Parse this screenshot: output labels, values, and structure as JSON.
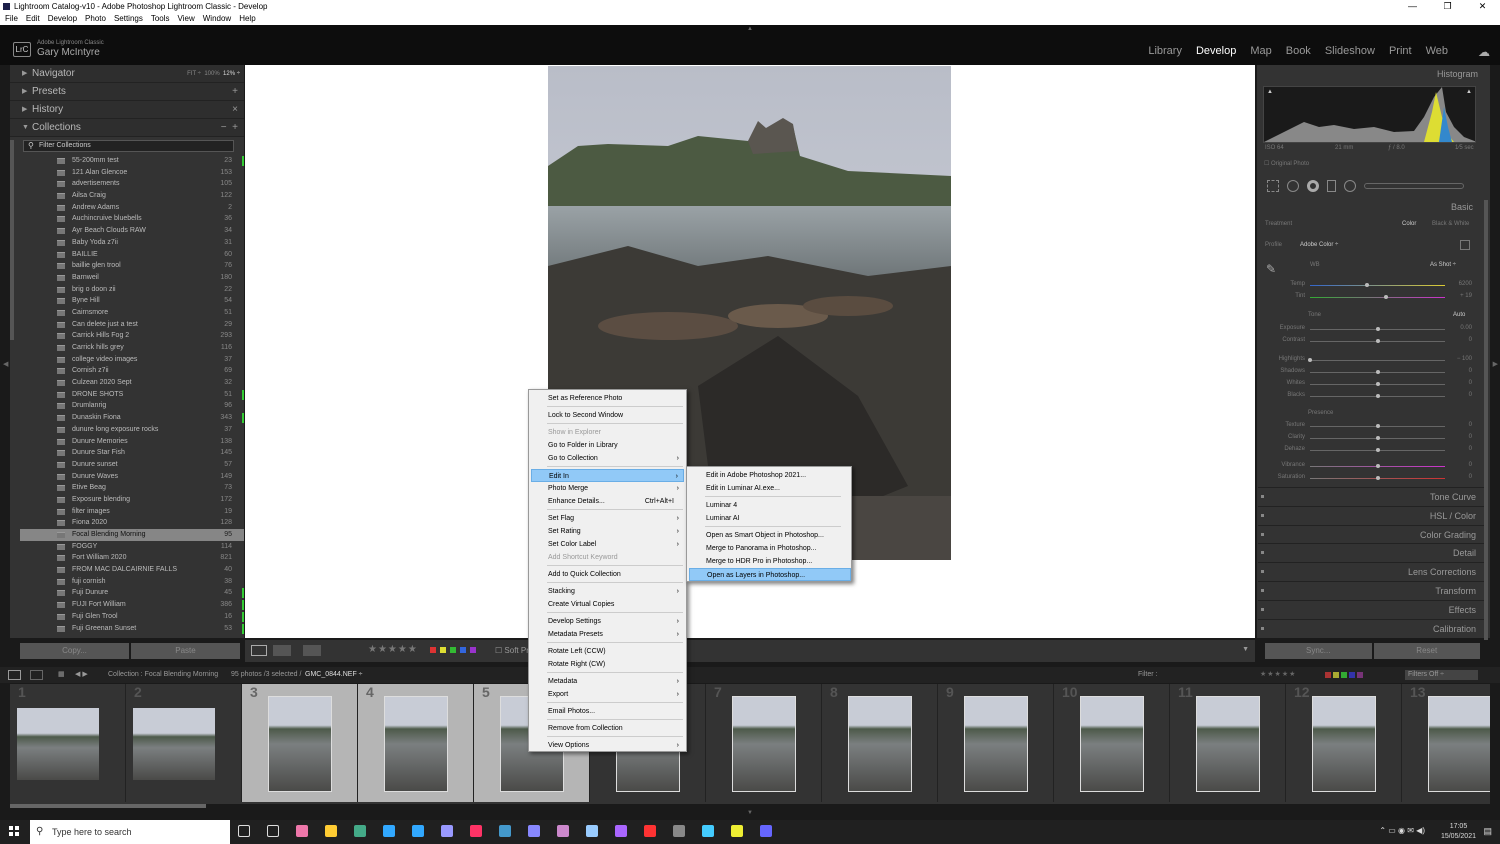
{
  "window": {
    "title": "Lightroom Catalog-v10 - Adobe Photoshop Lightroom Classic - Develop",
    "controls": [
      "—",
      "❐",
      "✕"
    ]
  },
  "menubar": [
    "File",
    "Edit",
    "Develop",
    "Photo",
    "Settings",
    "Tools",
    "View",
    "Window",
    "Help"
  ],
  "identity": {
    "app": "Adobe Lightroom Classic",
    "user": "Gary McIntyre",
    "logo": "LrC"
  },
  "modules": [
    "Library",
    "Develop",
    "Map",
    "Book",
    "Slideshow",
    "Print",
    "Web"
  ],
  "active_module": "Develop",
  "left_panel": {
    "navigator": {
      "label": "Navigator",
      "zoom_options": [
        "FIT ÷",
        "100%",
        "12% ÷"
      ]
    },
    "presets": "Presets",
    "history": "History",
    "collections": "Collections",
    "filter_placeholder": "Filter Collections",
    "items": [
      {
        "name": "55-200mm test",
        "count": "23",
        "mark": true
      },
      {
        "name": "121 Alan Glencoe",
        "count": "153"
      },
      {
        "name": "advertisements",
        "count": "105"
      },
      {
        "name": "Ailsa Craig",
        "count": "122"
      },
      {
        "name": "Andrew Adams",
        "count": "2"
      },
      {
        "name": "Auchincruive bluebells",
        "count": "36"
      },
      {
        "name": "Ayr Beach Clouds RAW",
        "count": "34"
      },
      {
        "name": "Baby Yoda z7ii",
        "count": "31"
      },
      {
        "name": "BAILLIE",
        "count": "60"
      },
      {
        "name": "baillie glen trool",
        "count": "76"
      },
      {
        "name": "Barnweil",
        "count": "180"
      },
      {
        "name": "brig o doon zii",
        "count": "22"
      },
      {
        "name": "Byne Hill",
        "count": "54"
      },
      {
        "name": "Cairnsmore",
        "count": "51"
      },
      {
        "name": "Can delete just a test",
        "count": "29"
      },
      {
        "name": "Carrick Hills Fog 2",
        "count": "293"
      },
      {
        "name": "Carrick hills grey",
        "count": "116"
      },
      {
        "name": "college video images",
        "count": "37"
      },
      {
        "name": "Cornish z7ii",
        "count": "69"
      },
      {
        "name": "Culzean 2020 Sept",
        "count": "32"
      },
      {
        "name": "DRONE SHOTS",
        "count": "51",
        "mark": true
      },
      {
        "name": "Drumlanrig",
        "count": "96"
      },
      {
        "name": "Dunaskin Fiona",
        "count": "343",
        "mark": true
      },
      {
        "name": "dunure long exposure rocks",
        "count": "37"
      },
      {
        "name": "Dunure Memories",
        "count": "138"
      },
      {
        "name": "Dunure Star Fish",
        "count": "145"
      },
      {
        "name": "Dunure sunset",
        "count": "57"
      },
      {
        "name": "Dunure Waves",
        "count": "149"
      },
      {
        "name": "Etive Beag",
        "count": "73"
      },
      {
        "name": "Exposure blending",
        "count": "172"
      },
      {
        "name": "filter images",
        "count": "19"
      },
      {
        "name": "Fiona 2020",
        "count": "128"
      },
      {
        "name": "Focal Blending Morning",
        "count": "95",
        "selected": true
      },
      {
        "name": "FOGGY",
        "count": "114"
      },
      {
        "name": "Fort William 2020",
        "count": "821"
      },
      {
        "name": "FROM MAC DALCAIRNIE FALLS",
        "count": "40"
      },
      {
        "name": "fuji cornish",
        "count": "38"
      },
      {
        "name": "Fuji Dunure",
        "count": "45",
        "mark": true
      },
      {
        "name": "FUJI Fort William",
        "count": "386",
        "mark": true
      },
      {
        "name": "Fuji Glen Trool",
        "count": "16",
        "mark": true
      },
      {
        "name": "Fuji Greenan Sunset",
        "count": "53",
        "mark": true
      }
    ],
    "copy": "Copy...",
    "paste": "Paste"
  },
  "toolbar": {
    "soft_proof": "Soft Pr"
  },
  "right_panel": {
    "histogram": "Histogram",
    "iso": "ISO 64",
    "focal": "21 mm",
    "aperture": "ƒ / 8.0",
    "shutter": "1⁄5 sec",
    "original_photo": "Original Photo",
    "basic": "Basic",
    "treatment": "Treatment",
    "color": "Color",
    "bw": "Black & White",
    "profile_label": "Profile",
    "profile": "Adobe Color ÷",
    "wb": "WB",
    "wb_value": "As Shot ÷",
    "sliders_wb": [
      {
        "name": "Temp",
        "value": "6200",
        "pos": 0.42
      },
      {
        "name": "Tint",
        "value": "+ 19",
        "pos": 0.56
      }
    ],
    "tone": "Tone",
    "auto": "Auto",
    "sliders_tone": [
      {
        "name": "Exposure",
        "value": "0.00",
        "pos": 0.5
      },
      {
        "name": "Contrast",
        "value": "0",
        "pos": 0.5
      },
      {
        "name": "Highlights",
        "value": "− 100",
        "pos": 0.0
      },
      {
        "name": "Shadows",
        "value": "0",
        "pos": 0.5
      },
      {
        "name": "Whites",
        "value": "0",
        "pos": 0.5
      },
      {
        "name": "Blacks",
        "value": "0",
        "pos": 0.5
      }
    ],
    "presence": "Presence",
    "sliders_presence": [
      {
        "name": "Texture",
        "value": "0",
        "pos": 0.5
      },
      {
        "name": "Clarity",
        "value": "0",
        "pos": 0.5
      },
      {
        "name": "Dehaze",
        "value": "0",
        "pos": 0.5
      },
      {
        "name": "Vibrance",
        "value": "0",
        "pos": 0.5
      },
      {
        "name": "Saturation",
        "value": "0",
        "pos": 0.5
      }
    ],
    "sections": [
      "Tone Curve",
      "HSL / Color",
      "Color Grading",
      "Detail",
      "Lens Corrections",
      "Transform",
      "Effects",
      "Calibration"
    ],
    "sync": "Sync...",
    "reset": "Reset"
  },
  "filmstrip": {
    "info": "Collection : Focal Blending Morning",
    "count": "95 photos /3 selected /",
    "file": "GMC_0844.NEF ÷",
    "filter": "Filter :",
    "filters_off": "Filters Off ÷",
    "cells": [
      "1",
      "2",
      "3",
      "4",
      "5",
      "6",
      "7",
      "8",
      "9",
      "10",
      "11",
      "12",
      "13"
    ]
  },
  "context_menu": {
    "items": [
      {
        "label": "Set as Reference Photo"
      },
      {
        "label": "Lock to Second Window"
      },
      {
        "label": "Show in Explorer",
        "disabled": true
      },
      {
        "label": "Go to Folder in Library"
      },
      {
        "label": "Go to Collection",
        "sub": true
      },
      {
        "label": "Edit In",
        "sub": true,
        "hl": true
      },
      {
        "label": "Photo Merge",
        "sub": true
      },
      {
        "label": "Enhance Details...",
        "shortcut": "Ctrl+Alt+I"
      },
      {
        "label": "Set Flag",
        "sub": true
      },
      {
        "label": "Set Rating",
        "sub": true
      },
      {
        "label": "Set Color Label",
        "sub": true
      },
      {
        "label": "Add Shortcut Keyword",
        "disabled": true
      },
      {
        "label": "Add to Quick Collection"
      },
      {
        "label": "Stacking",
        "sub": true
      },
      {
        "label": "Create Virtual Copies"
      },
      {
        "label": "Develop Settings",
        "sub": true
      },
      {
        "label": "Metadata Presets",
        "sub": true
      },
      {
        "label": "Rotate Left (CCW)"
      },
      {
        "label": "Rotate Right (CW)"
      },
      {
        "label": "Metadata",
        "sub": true
      },
      {
        "label": "Export",
        "sub": true
      },
      {
        "label": "Email Photos..."
      },
      {
        "label": "Remove from Collection"
      },
      {
        "label": "View Options",
        "sub": true
      }
    ],
    "submenu": [
      {
        "label": "Edit in Adobe Photoshop 2021..."
      },
      {
        "label": "Edit in Luminar AI.exe..."
      },
      {
        "label": "Luminar 4"
      },
      {
        "label": "Luminar AI"
      },
      {
        "label": "Open as Smart Object in Photoshop..."
      },
      {
        "label": "Merge to Panorama in Photoshop..."
      },
      {
        "label": "Merge to HDR Pro in Photoshop..."
      },
      {
        "label": "Open as Layers in Photoshop...",
        "hl": true
      }
    ]
  },
  "taskbar": {
    "search": "Type here to search",
    "time": "17:05",
    "date": "15/05/2021",
    "icons": [
      "task-view-icon",
      "timeline-icon",
      "photos-icon",
      "file-explorer-icon",
      "chrome-icon",
      "lightroom-icon",
      "photoshop-icon",
      "premiere-icon",
      "indesign-icon",
      "app-icon",
      "app-icon",
      "app-icon",
      "app-icon",
      "app-icon",
      "acrobat-icon",
      "app-icon",
      "app-icon",
      "app-icon",
      "app-icon"
    ]
  }
}
